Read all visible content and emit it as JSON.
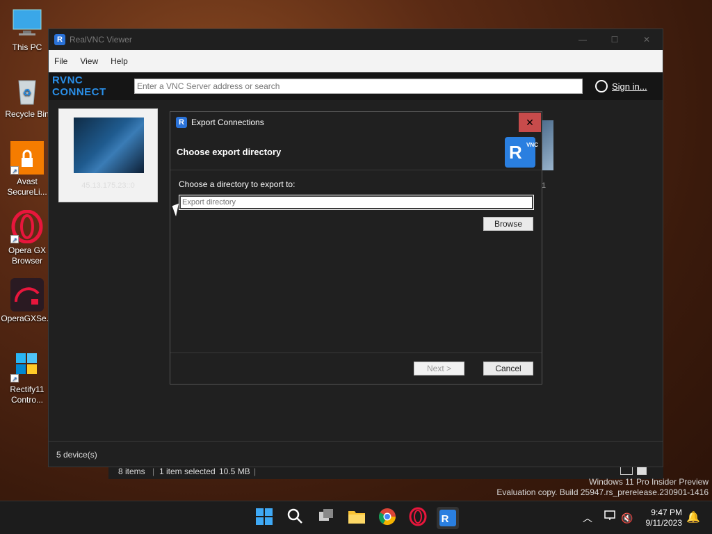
{
  "desktop": {
    "icons": [
      {
        "label": "This PC"
      },
      {
        "label": "Recycle Bin"
      },
      {
        "label": "Avast SecureLi..."
      },
      {
        "label": "Opera GX Browser"
      },
      {
        "label": "OperaGXSe..."
      },
      {
        "label": "Rectify11 Contro..."
      }
    ]
  },
  "explorer": {
    "items": "8 items",
    "selected": "1 item selected",
    "size": "10.5 MB"
  },
  "vnc": {
    "title": "RealVNC Viewer",
    "menu": [
      "File",
      "View",
      "Help"
    ],
    "logo": "RVNC CONNECT",
    "search_placeholder": "Enter a VNC Server address or search",
    "sign_in": "Sign in...",
    "device_caption": "45.13.175.23::0",
    "device_caption_2": "1",
    "footer": "5 device(s)"
  },
  "dialog": {
    "title": "Export Connections",
    "heading": "Choose export directory",
    "label": "Choose a directory to export to:",
    "input_placeholder": "Export directory",
    "browse": "Browse",
    "next": "Next >",
    "cancel": "Cancel",
    "close": "✕"
  },
  "watermark": {
    "line1": "Windows 11 Pro Insider Preview",
    "line2": "Evaluation copy. Build 25947.rs_prerelease.230901-1416"
  },
  "taskbar": {
    "time": "9:47 PM",
    "date": "9/11/2023"
  },
  "colors": {
    "accent": "#2a7fe0",
    "close_red": "#c74b4b"
  }
}
